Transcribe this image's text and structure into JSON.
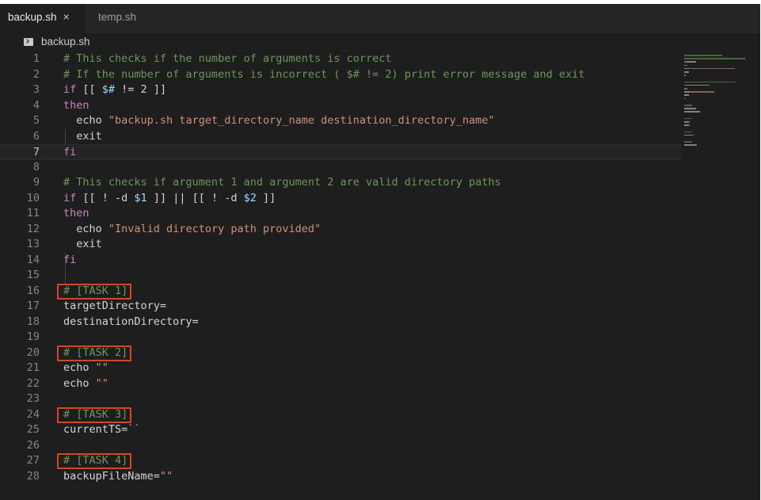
{
  "tabs": [
    {
      "label": "backup.sh",
      "active": true,
      "close": "×"
    },
    {
      "label": "temp.sh",
      "active": false
    }
  ],
  "breadcrumb": {
    "icon": "terminal-icon",
    "label": "backup.sh"
  },
  "active_line": 7,
  "highlight_color": "#e0421d",
  "code": [
    {
      "n": "1",
      "tokens": [
        {
          "t": "# This checks if the number of arguments is correct",
          "c": "comment"
        }
      ]
    },
    {
      "n": "2",
      "tokens": [
        {
          "t": "# If the number of arguments is incorrect ( $# != 2) print error message and exit",
          "c": "comment"
        }
      ]
    },
    {
      "n": "3",
      "tokens": [
        {
          "t": "if ",
          "c": "keyword"
        },
        {
          "t": "[[ ",
          "c": "punct"
        },
        {
          "t": "$#",
          "c": "var"
        },
        {
          "t": " != 2 ]]",
          "c": "punct"
        }
      ]
    },
    {
      "n": "4",
      "tokens": [
        {
          "t": "then",
          "c": "keyword"
        }
      ]
    },
    {
      "n": "5",
      "tokens": [
        {
          "t": "  echo ",
          "c": "ident"
        },
        {
          "t": "\"backup.sh target_directory_name destination_directory_name\"",
          "c": "string"
        }
      ]
    },
    {
      "n": "6",
      "tokens": [
        {
          "t": "  exit",
          "c": "ident"
        }
      ]
    },
    {
      "n": "7",
      "tokens": [
        {
          "t": "fi",
          "c": "keyword"
        }
      ]
    },
    {
      "n": "8",
      "tokens": []
    },
    {
      "n": "9",
      "tokens": [
        {
          "t": "# This checks if argument 1 and argument 2 are valid directory paths",
          "c": "comment"
        }
      ]
    },
    {
      "n": "10",
      "tokens": [
        {
          "t": "if ",
          "c": "keyword"
        },
        {
          "t": "[[ ! -d ",
          "c": "punct"
        },
        {
          "t": "$1",
          "c": "var"
        },
        {
          "t": " ]] || [[ ! -d ",
          "c": "punct"
        },
        {
          "t": "$2",
          "c": "var"
        },
        {
          "t": " ]]",
          "c": "punct"
        }
      ]
    },
    {
      "n": "11",
      "tokens": [
        {
          "t": "then",
          "c": "keyword"
        }
      ]
    },
    {
      "n": "12",
      "tokens": [
        {
          "t": "  echo ",
          "c": "ident"
        },
        {
          "t": "\"Invalid directory path provided\"",
          "c": "string"
        }
      ]
    },
    {
      "n": "13",
      "tokens": [
        {
          "t": "  exit",
          "c": "ident"
        }
      ]
    },
    {
      "n": "14",
      "tokens": [
        {
          "t": "fi",
          "c": "keyword"
        }
      ]
    },
    {
      "n": "15",
      "tokens": []
    },
    {
      "n": "16",
      "tokens": [
        {
          "t": "# [TASK 1]",
          "c": "comment"
        }
      ]
    },
    {
      "n": "17",
      "tokens": [
        {
          "t": "targetDirectory=",
          "c": "ident"
        }
      ]
    },
    {
      "n": "18",
      "tokens": [
        {
          "t": "destinationDirectory=",
          "c": "ident"
        }
      ]
    },
    {
      "n": "19",
      "tokens": []
    },
    {
      "n": "20",
      "tokens": [
        {
          "t": "# [TASK 2]",
          "c": "comment"
        }
      ]
    },
    {
      "n": "21",
      "tokens": [
        {
          "t": "echo ",
          "c": "ident"
        },
        {
          "t": "\"\"",
          "c": "string"
        }
      ]
    },
    {
      "n": "22",
      "tokens": [
        {
          "t": "echo ",
          "c": "ident"
        },
        {
          "t": "\"\"",
          "c": "string"
        }
      ]
    },
    {
      "n": "23",
      "tokens": []
    },
    {
      "n": "24",
      "tokens": [
        {
          "t": "# [TASK 3]",
          "c": "comment"
        }
      ]
    },
    {
      "n": "25",
      "tokens": [
        {
          "t": "currentTS=",
          "c": "ident"
        },
        {
          "t": "``",
          "c": "string"
        }
      ]
    },
    {
      "n": "26",
      "tokens": []
    },
    {
      "n": "27",
      "tokens": [
        {
          "t": "# [TASK 4]",
          "c": "comment"
        }
      ]
    },
    {
      "n": "28",
      "tokens": [
        {
          "t": "backupFileName=",
          "c": "ident"
        },
        {
          "t": "\"\"",
          "c": "string"
        }
      ]
    }
  ],
  "task_boxes": [
    "16",
    "20",
    "24",
    "27"
  ]
}
